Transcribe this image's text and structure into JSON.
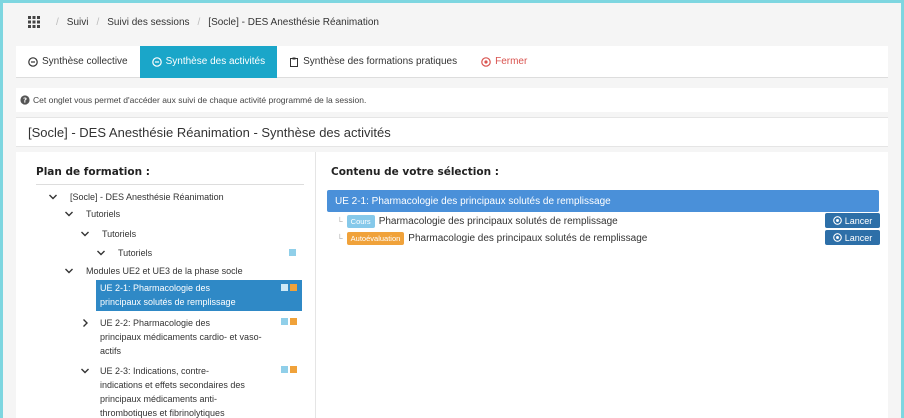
{
  "breadcrumb": {
    "items": [
      "Suivi",
      "Suivi des sessions",
      "[Socle] - DES Anesthésie Réanimation"
    ]
  },
  "tabs": [
    {
      "label": "Synthèse collective",
      "icon": "circle-arrow-icon",
      "active": false
    },
    {
      "label": "Synthèse des activités",
      "icon": "circle-arrow-icon",
      "active": true
    },
    {
      "label": "Synthèse des formations pratiques",
      "icon": "clipboard-icon",
      "active": false
    },
    {
      "label": "Fermer",
      "icon": "close-circle-icon",
      "active": false
    }
  ],
  "info": {
    "text": "Cet onglet vous permet d'accéder aux suivi de chaque activité programmé de la session."
  },
  "page": {
    "title": "[Socle] - DES Anesthésie Réanimation - Synthèse des activités"
  },
  "left": {
    "title": "Plan de formation :",
    "tree": [
      {
        "lines": [
          "[Socle] - DES Anesthésie Réanimation"
        ]
      },
      {
        "lines": [
          "Tutoriels"
        ]
      },
      {
        "lines": [
          "Tutoriels"
        ]
      },
      {
        "lines": [
          "Tutoriels"
        ]
      },
      {
        "lines": [
          "Modules UE2 et UE3 de la phase socle"
        ]
      },
      {
        "lines": [
          "UE 2-1: Pharmacologie des",
          "principaux solutés de remplissage"
        ]
      },
      {
        "lines": [
          "UE 2-2: Pharmacologie des",
          "principaux médicaments cardio- et vaso-",
          "actifs"
        ]
      },
      {
        "lines": [
          "UE 2-3: Indications, contre-",
          "indications et effets secondaires des",
          "principaux médicaments anti-",
          "thrombotiques et fibrinolytiques"
        ]
      }
    ]
  },
  "right": {
    "title": "Contenu de votre sélection :",
    "header": "UE 2-1: Pharmacologie des principaux solutés de remplissage",
    "rows": [
      {
        "badge": "Cours",
        "label": "Pharmacologie des principaux solutés de remplissage",
        "action": "Lancer"
      },
      {
        "badge": "Autoévaluation",
        "label": "Pharmacologie des principaux solutés de remplissage",
        "action": "Lancer"
      }
    ]
  },
  "colors": {
    "accent": "#1aa6c9",
    "selected": "#2f89c6",
    "header": "#4a90d9",
    "cours": "#86c9ea",
    "auto": "#f0a23a",
    "button": "#2d6fa8",
    "close": "#d9534f"
  }
}
